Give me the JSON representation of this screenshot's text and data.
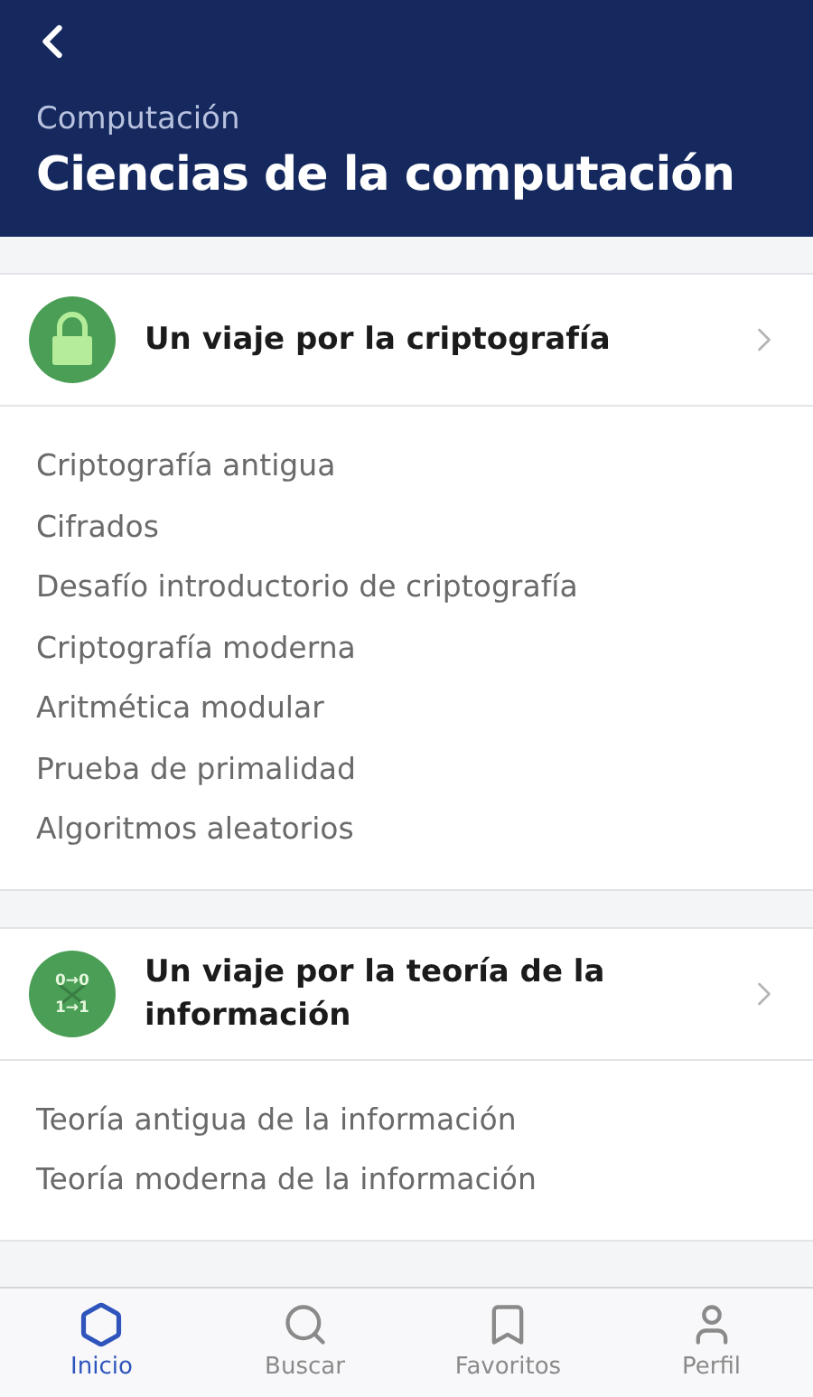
{
  "header": {
    "subtitle": "Computación",
    "title": "Ciencias de la computación"
  },
  "courses": [
    {
      "title": "Un viaje por la criptografía",
      "icon": {
        "kind": "lock"
      },
      "lessons": [
        "Criptografía antigua",
        "Cifrados",
        "Desafío introductorio de criptografía",
        "Criptografía moderna",
        "Aritmética modular",
        "Prueba de primalidad",
        "Algoritmos aleatorios"
      ]
    },
    {
      "title": "Un viaje por la teoría de la información",
      "icon": {
        "kind": "bits",
        "lines": [
          "0→0",
          "1→1"
        ]
      },
      "lessons": [
        "Teoría antigua de la información",
        "Teoría moderna de la información"
      ]
    }
  ],
  "tabs": [
    {
      "label": "Inicio",
      "kind": "home",
      "selected": true
    },
    {
      "label": "Buscar",
      "kind": "search",
      "selected": false
    },
    {
      "label": "Favoritos",
      "kind": "bookmark",
      "selected": false
    },
    {
      "label": "Perfil",
      "kind": "profile",
      "selected": false
    }
  ]
}
